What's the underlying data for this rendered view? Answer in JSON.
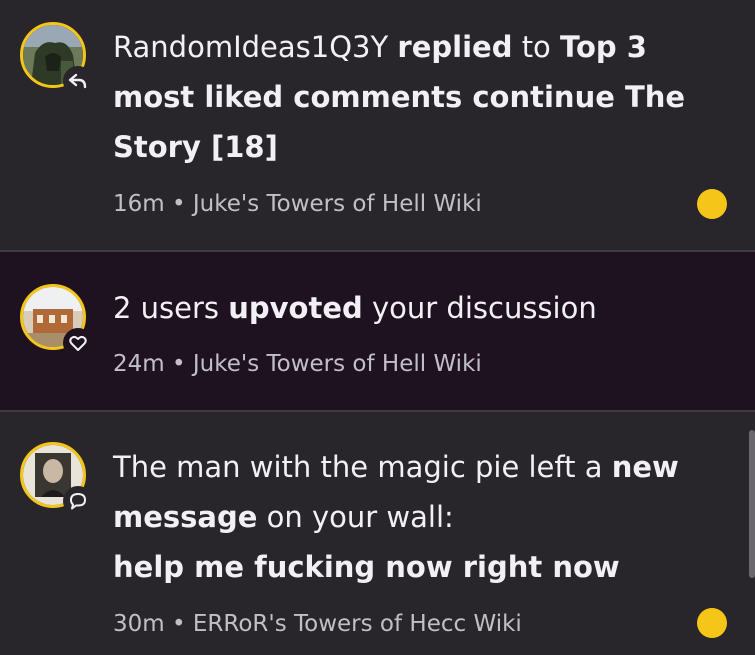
{
  "notifications": [
    {
      "actor": "RandomIdeas1Q3Y",
      "action": "replied",
      "connector": "to",
      "target": "Top 3 most liked comments continue The Story [18]",
      "time": "16m",
      "wiki": "Juke's Towers of Hell Wiki",
      "unread": true,
      "badge_icon": "reply-icon"
    },
    {
      "prefix": "2 users",
      "action": "upvoted",
      "suffix": "your discussion",
      "time": "24m",
      "wiki": "Juke's Towers of Hell Wiki",
      "unread": false,
      "badge_icon": "heart-icon"
    },
    {
      "actor": "The man with the magic pie left a",
      "action": "new message",
      "suffix": "on your wall:",
      "message": "help me fucking now right now",
      "time": "30m",
      "wiki": "ERRoR's Towers of Hecc Wiki",
      "unread": true,
      "badge_icon": "comment-icon"
    }
  ],
  "separator": "•",
  "colors": {
    "accent": "#f5c518",
    "background": "#28262a",
    "highlight_background": "#1e1120",
    "text": "#f2f0f4",
    "meta_text": "#c2bfc6"
  }
}
